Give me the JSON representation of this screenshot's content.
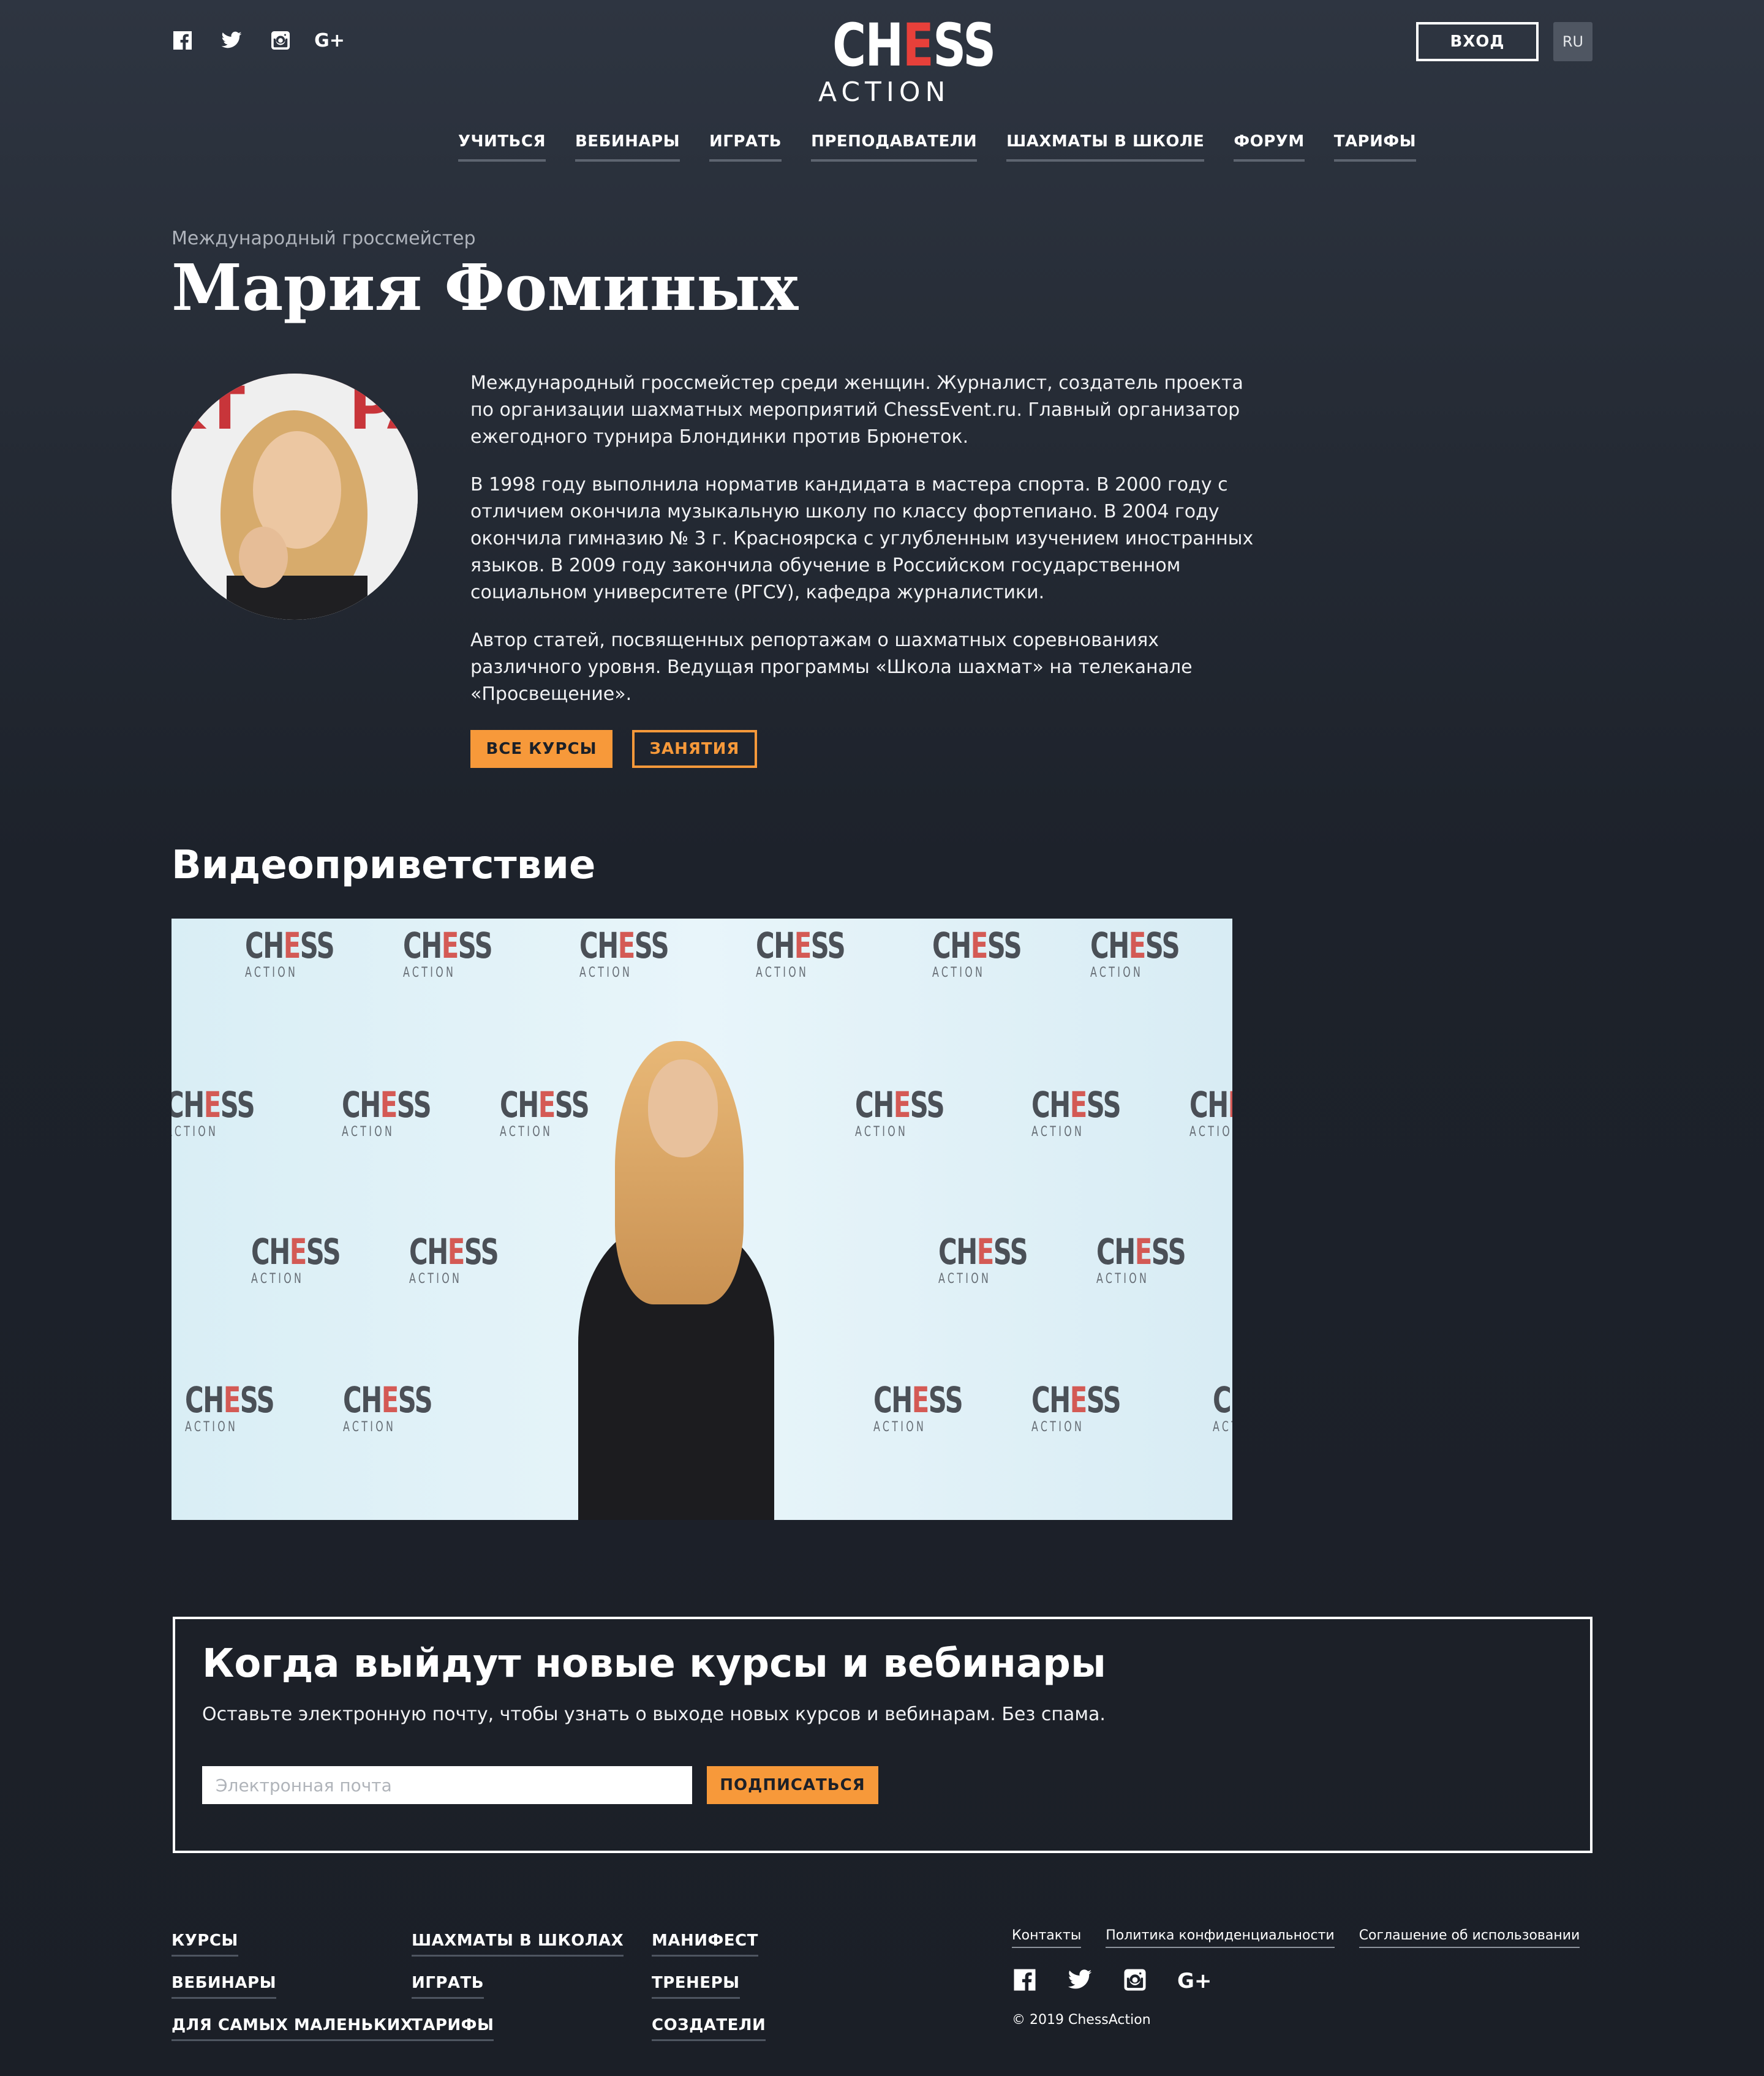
{
  "header": {
    "logo_top": "CH",
    "logo_red": "E",
    "logo_top2": "SS",
    "logo_bottom": "ACTION",
    "login_label": "ВХОД",
    "lang_label": "RU",
    "social_icons": [
      "facebook-icon",
      "twitter-icon",
      "instagram-icon",
      "google-plus-icon"
    ],
    "gplus_text": "G+"
  },
  "nav": {
    "items": [
      "УЧИТЬСЯ",
      "ВЕБИНАРЫ",
      "ИГРАТЬ",
      "ПРЕПОДАВАТЕЛИ",
      "ШАХМАТЫ В ШКОЛЕ",
      "ФОРУМ",
      "ТАРИФЫ"
    ]
  },
  "profile": {
    "subtitle": "Международный гроссмейстер",
    "name": "Мария Фоминых",
    "bio": [
      "Международный гроссмейстер среди женщин. Журналист, создатель проекта по организации шахматных мероприятий ChessEvent.ru. Главный организатор ежегодного турнира Блондинки против Брюнеток.",
      "В 1998 году выполнила норматив кандидата в мастера спорта. В 2000 году с отличием окончила музыкальную школу по классу фортепиано. В 2004 году окончила гимназию № 3 г. Красноярска с углубленным изучением иностранных языков. В 2009 году закончила обучение в Российском государственном социальном университете (РГСУ), кафедра журналистики.",
      "Автор статей, посвященных репортажам о шахматных соревнованиях различного уровня. Ведущая программы «Школа шахмат» на телеканале «Просвещение»."
    ],
    "btn_all_courses": "ВСЕ КУРСЫ",
    "btn_lessons": "ЗАНЯТИЯ"
  },
  "video": {
    "title": "Видеоприветствие",
    "watermark_top": "CH",
    "watermark_red": "E",
    "watermark_top2": "SS",
    "watermark_bottom": "ACTION"
  },
  "subscribe": {
    "title": "Когда выйдут новые курсы и вебинары",
    "description": "Оставьте электронную почту, чтобы узнать о выходе новых курсов и вебинарам. Без спама.",
    "placeholder": "Электронная почта",
    "button": "ПОДПИСАТЬСЯ"
  },
  "footer": {
    "col1": [
      "КУРСЫ",
      "ВЕБИНАРЫ",
      "ДЛЯ САМЫХ МАЛЕНЬКИХ"
    ],
    "col2": [
      "ШАХМАТЫ В ШКОЛАХ",
      "ИГРАТЬ",
      "ТАРИФЫ"
    ],
    "col3": [
      "МАНИФЕСТ",
      "ТРЕНЕРЫ",
      "СОЗДАТЕЛИ"
    ],
    "links": [
      "Контакты",
      "Политика конфиденциальности",
      "Соглашение об использовании"
    ],
    "copyright": "© 2019 ChessAction"
  },
  "colors": {
    "accent": "#f7993a",
    "brand_red": "#e7403a",
    "background": "#1d222b"
  }
}
